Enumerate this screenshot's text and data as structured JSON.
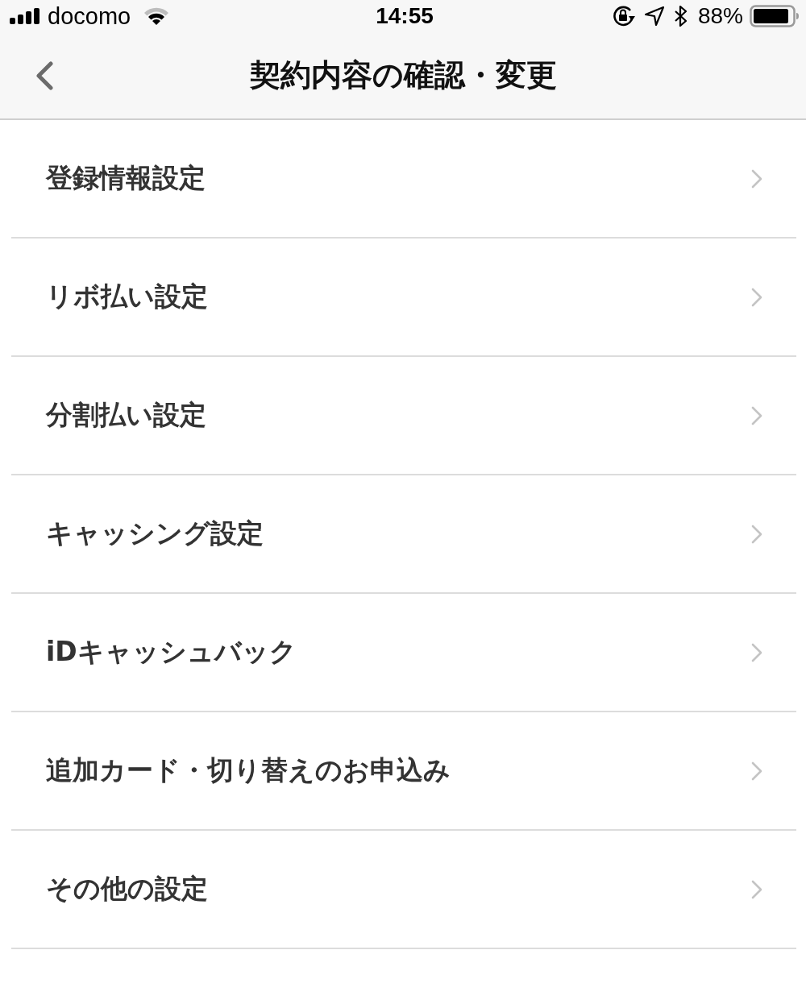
{
  "status_bar": {
    "carrier": "docomo",
    "time": "14:55",
    "battery": "88%"
  },
  "nav_bar": {
    "title": "契約内容の確認・変更"
  },
  "menu_items": [
    {
      "label": "登録情報設定"
    },
    {
      "label": "リボ払い設定"
    },
    {
      "label": "分割払い設定"
    },
    {
      "label": "キャッシング設定"
    },
    {
      "label": "iDキャッシュバック"
    },
    {
      "label": "追加カード・切り替えのお申込み"
    },
    {
      "label": "その他の設定"
    }
  ]
}
